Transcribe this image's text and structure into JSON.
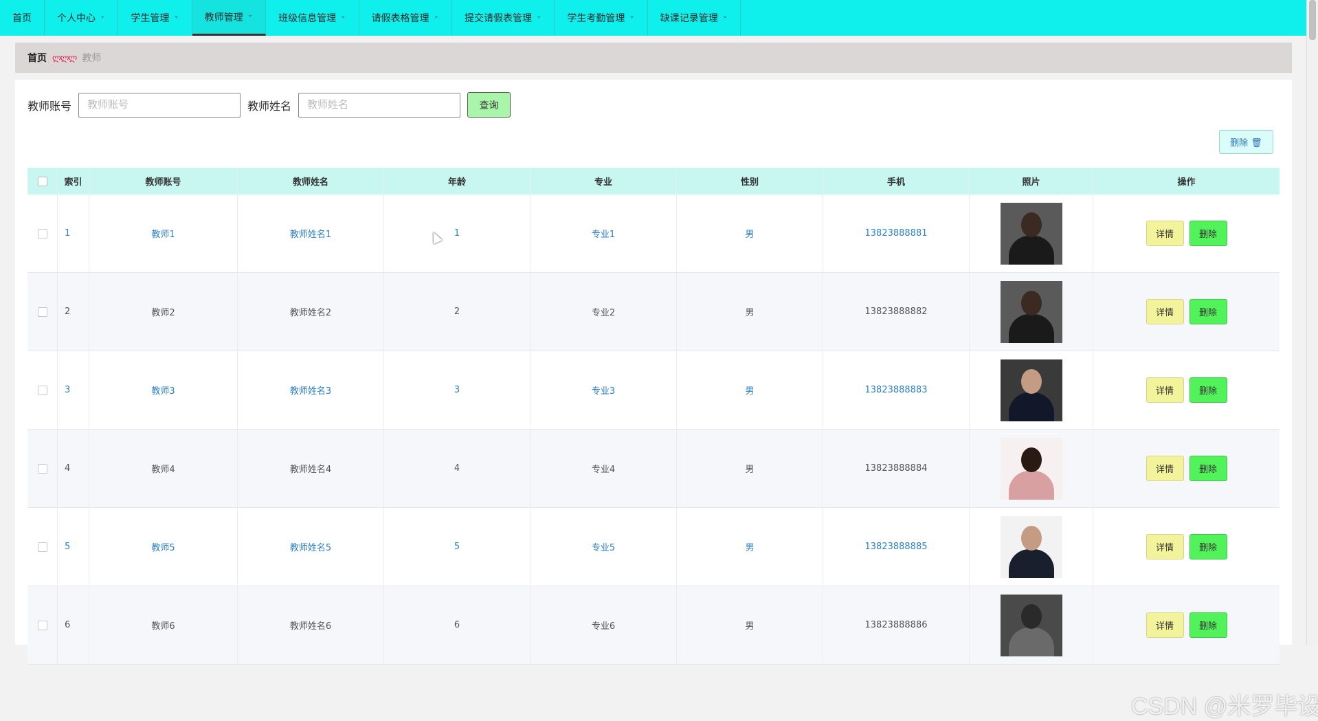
{
  "nav": {
    "items": [
      {
        "label": "首页",
        "dropdown": false,
        "active": false
      },
      {
        "label": "个人中心",
        "dropdown": true,
        "active": false
      },
      {
        "label": "学生管理",
        "dropdown": true,
        "active": false
      },
      {
        "label": "教师管理",
        "dropdown": true,
        "active": true
      },
      {
        "label": "班级信息管理",
        "dropdown": true,
        "active": false
      },
      {
        "label": "请假表格管理",
        "dropdown": true,
        "active": false
      },
      {
        "label": "提交请假表管理",
        "dropdown": true,
        "active": false
      },
      {
        "label": "学生考勤管理",
        "dropdown": true,
        "active": false
      },
      {
        "label": "缺课记录管理",
        "dropdown": true,
        "active": false
      }
    ],
    "bg_color": "#0ff0ec"
  },
  "breadcrumb": {
    "home": "首页",
    "separator": "ლლლ",
    "current": "教师"
  },
  "search": {
    "account_label": "教师账号",
    "account_placeholder": "教师账号",
    "account_value": "",
    "name_label": "教师姓名",
    "name_placeholder": "教师姓名",
    "name_value": "",
    "query_label": "查询"
  },
  "bulk_delete": {
    "label": "删除 🗑"
  },
  "table": {
    "headers": {
      "index": "索引",
      "account": "教师账号",
      "name": "教师姓名",
      "age": "年龄",
      "major": "专业",
      "gender": "性别",
      "phone": "手机",
      "photo": "照片",
      "actions": "操作"
    },
    "rows": [
      {
        "index": "1",
        "account": "教师1",
        "name": "教师姓名1",
        "age": "1",
        "major": "专业1",
        "gender": "男",
        "phone": "13823888881",
        "photo": "woman-black-suit"
      },
      {
        "index": "2",
        "account": "教师2",
        "name": "教师姓名2",
        "age": "2",
        "major": "专业2",
        "gender": "男",
        "phone": "13823888882",
        "photo": "woman-black-suit"
      },
      {
        "index": "3",
        "account": "教师3",
        "name": "教师姓名3",
        "age": "3",
        "major": "专业3",
        "gender": "男",
        "phone": "13823888883",
        "photo": "man-suit"
      },
      {
        "index": "4",
        "account": "教师4",
        "name": "教师姓名4",
        "age": "4",
        "major": "专业4",
        "gender": "男",
        "phone": "13823888884",
        "photo": "woman-pink-blouse"
      },
      {
        "index": "5",
        "account": "教师5",
        "name": "教师姓名5",
        "age": "5",
        "major": "专业5",
        "gender": "男",
        "phone": "13823888885",
        "photo": "man-white-shirt"
      },
      {
        "index": "6",
        "account": "教师6",
        "name": "教师姓名6",
        "age": "6",
        "major": "专业6",
        "gender": "男",
        "phone": "13823888886",
        "photo": "man-grey-jacket"
      }
    ],
    "detail_label": "详情",
    "delete_label": "删除"
  },
  "watermark": "CSDN @米罗毕设",
  "colors": {
    "nav_bg": "#0ff0ec",
    "header_bg": "#c8f7f2",
    "link_blue": "#2f80c8",
    "detail_btn": "#f3f39b",
    "delete_btn": "#52f25a",
    "query_btn": "#a9f5a9"
  }
}
